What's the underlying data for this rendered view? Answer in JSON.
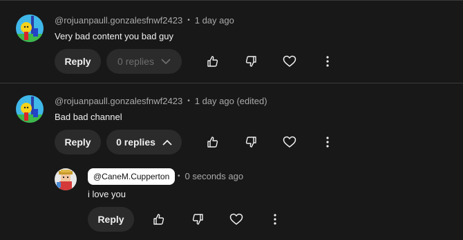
{
  "comments": [
    {
      "author": "@rojuanpaull.gonzalesfnwf2423",
      "separator": "•",
      "time": "1 day ago",
      "text": "Very bad content you bad guy",
      "reply_label": "Reply",
      "replies_label": "0 replies",
      "replies_state": "disabled",
      "icons": [
        "like-icon",
        "dislike-icon",
        "heart-icon",
        "more-vert-icon"
      ]
    },
    {
      "author": "@rojuanpaull.gonzalesfnwf2423",
      "separator": "•",
      "time": "1 day ago (edited)",
      "text": "Bad bad channel",
      "reply_label": "Reply",
      "replies_label": "0 replies",
      "replies_state": "expanded",
      "icons": [
        "like-icon",
        "dislike-icon",
        "heart-icon",
        "more-vert-icon"
      ]
    }
  ],
  "reply": {
    "author": "@CaneM.Cupperton",
    "separator": "•",
    "time": "0 seconds ago",
    "text": "i love you",
    "reply_label": "Reply",
    "icons": [
      "like-icon",
      "dislike-icon",
      "heart-icon",
      "more-vert-icon"
    ]
  },
  "colors": {
    "background": "#181818",
    "pill": "#2b2b2b",
    "meta_text": "#aaaaaa",
    "text": "#f1f1f1",
    "mention_bg": "#ffffff"
  }
}
